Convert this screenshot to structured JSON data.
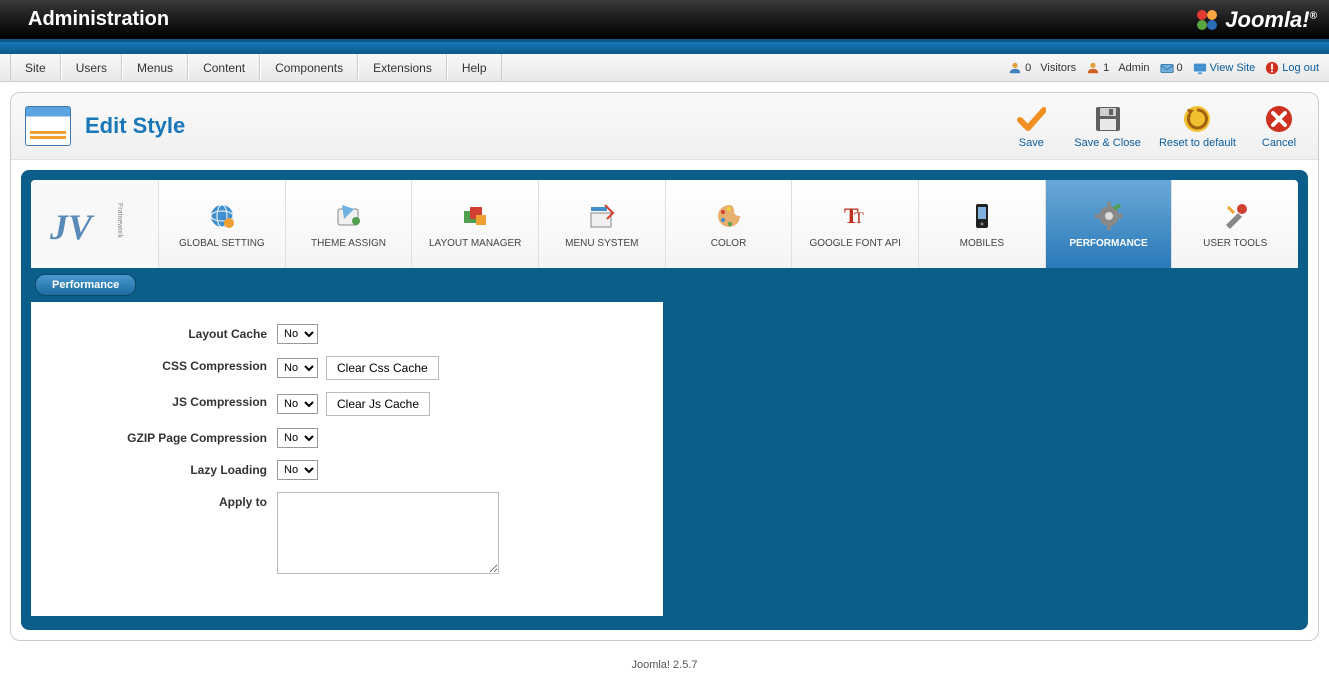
{
  "header": {
    "title": "Administration",
    "brand": "Joomla!"
  },
  "menu": {
    "items": [
      "Site",
      "Users",
      "Menus",
      "Content",
      "Components",
      "Extensions",
      "Help"
    ]
  },
  "status": {
    "visitors_count": "0",
    "visitors_label": "Visitors",
    "admin_count": "1",
    "admin_label": "Admin",
    "messages_count": "0",
    "view_site": "View Site",
    "logout": "Log out"
  },
  "page": {
    "title": "Edit Style"
  },
  "toolbar": {
    "save": "Save",
    "save_close": "Save & Close",
    "reset": "Reset to default",
    "cancel": "Cancel"
  },
  "tabs": {
    "items": [
      {
        "label": "GLOBAL SETTING",
        "icon": "globe"
      },
      {
        "label": "THEME ASSIGN",
        "icon": "palette-assign"
      },
      {
        "label": "LAYOUT MANAGER",
        "icon": "layout"
      },
      {
        "label": "MENU SYSTEM",
        "icon": "menu"
      },
      {
        "label": "COLOR",
        "icon": "color-palette"
      },
      {
        "label": "GOOGLE FONT API",
        "icon": "font"
      },
      {
        "label": "MOBILES",
        "icon": "mobile"
      },
      {
        "label": "PERFORMANCE",
        "icon": "gear"
      },
      {
        "label": "USER TOOLS",
        "icon": "tools"
      }
    ],
    "active_index": 7
  },
  "sub_tab": "Performance",
  "form": {
    "layout_cache": {
      "label": "Layout Cache",
      "value": "No"
    },
    "css_compression": {
      "label": "CSS Compression",
      "value": "No",
      "button": "Clear Css Cache"
    },
    "js_compression": {
      "label": "JS Compression",
      "value": "No",
      "button": "Clear Js Cache"
    },
    "gzip": {
      "label": "GZIP Page Compression",
      "value": "No"
    },
    "lazy_loading": {
      "label": "Lazy Loading",
      "value": "No"
    },
    "apply_to": {
      "label": "Apply to",
      "value": ""
    }
  },
  "footer": "Joomla! 2.5.7"
}
